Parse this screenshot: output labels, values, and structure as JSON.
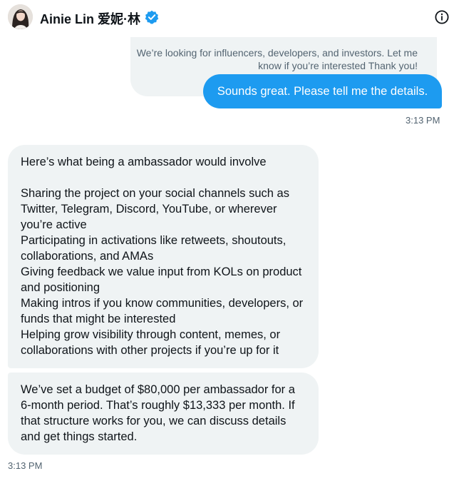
{
  "header": {
    "name": "Ainie Lin 爱妮·林",
    "verified": true,
    "avatar_icon": "avatar-photo",
    "info_icon": "info-icon"
  },
  "messages": {
    "context_text": "We’re looking for influencers, developers, and investors. Let me know if you’re interested Thank you!",
    "sent_text": "Sounds great. Please tell me the details.",
    "sent_time": "3:13 PM",
    "received_1": {
      "intro": "Here’s what being a ambassador would involve",
      "items": [
        "Sharing the project on your social channels such as Twitter, Telegram, Discord, YouTube, or wherever you’re active",
        "Participating in activations like retweets, shoutouts, collaborations, and AMAs",
        "Giving feedback we value input from KOLs on product and positioning",
        "Making intros if you know communities, developers, or funds that might be interested",
        "Helping grow visibility through content, memes, or collaborations with other projects if you’re up for it"
      ]
    },
    "received_2": "We’ve set a budget of $80,000 per ambassador for a 6-month period. That’s roughly $13,333 per month. If that structure works for you, we can discuss details and get things started.",
    "received_time": "3:13 PM"
  },
  "colors": {
    "accent": "#1d9bf0",
    "bubble_gray": "#eff3f4",
    "muted_text": "#536471"
  }
}
